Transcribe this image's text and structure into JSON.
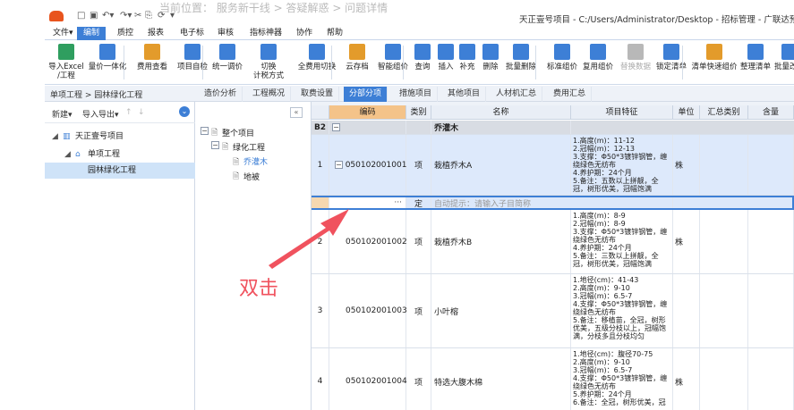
{
  "titlebar": {
    "ghost_text": "当前位置：  服务新干线  >  答疑解惑  >  问题详情",
    "title": "天正壹号项目 - C:/Users/Administrator/Desktop - 招标管理 - 广联达预算计价"
  },
  "menu": [
    "文件▾",
    "编制",
    "质控",
    "报表",
    "电子标",
    "审核",
    "指标神器",
    "协作",
    "帮助"
  ],
  "menu_active": "编制",
  "ribbon": [
    {
      "label": "导入Excel",
      "label2": "/工程",
      "icon": "import-excel-icon",
      "color": "#2f9e5f"
    },
    {
      "label": "量价一体化",
      "label2": "",
      "icon": "quantity-price-icon",
      "color": "#3d7fd6"
    },
    {
      "label": "费用查看",
      "label2": "",
      "icon": "fee-view-icon",
      "color": "#e39b2b"
    },
    {
      "label": "项目自检",
      "label2": "",
      "icon": "self-check-icon",
      "color": "#3d7fd6"
    },
    {
      "label": "统一调价",
      "label2": "",
      "icon": "unify-price-icon",
      "color": "#3d7fd6"
    },
    {
      "label": "切换",
      "label2": "计税方式",
      "icon": "tax-switch-icon",
      "color": "#3d7fd6"
    },
    {
      "label": "全费用切换",
      "label2": "",
      "icon": "full-fee-icon",
      "color": "#3d7fd6"
    },
    {
      "label": "云存档",
      "label2": "",
      "icon": "cloud-save-icon",
      "color": "#e39b2b"
    },
    {
      "label": "智能组价",
      "label2": "",
      "icon": "smart-price-icon",
      "color": "#3d7fd6"
    },
    {
      "label": "查询",
      "label2": "",
      "icon": "query-icon",
      "color": "#3d7fd6"
    },
    {
      "label": "插入",
      "label2": "",
      "icon": "insert-icon",
      "color": "#3d7fd6"
    },
    {
      "label": "补充",
      "label2": "",
      "icon": "supplement-icon",
      "color": "#3d7fd6"
    },
    {
      "label": "删除",
      "label2": "",
      "icon": "delete-icon",
      "color": "#3d7fd6"
    },
    {
      "label": "批量删除",
      "label2": "",
      "icon": "batch-delete-icon",
      "color": "#3d7fd6"
    },
    {
      "label": "标准组价",
      "label2": "",
      "icon": "standard-price-icon",
      "color": "#3d7fd6"
    },
    {
      "label": "复用组价",
      "label2": "",
      "icon": "reuse-price-icon",
      "color": "#3d7fd6"
    },
    {
      "label": "替换数据",
      "label2": "",
      "icon": "replace-data-icon",
      "color": "#b8b8b8"
    },
    {
      "label": "锁定清单",
      "label2": "",
      "icon": "lock-list-icon",
      "color": "#3d7fd6"
    },
    {
      "label": "清单快速组价",
      "label2": "",
      "icon": "quick-price-icon",
      "color": "#e39b2b"
    },
    {
      "label": "整理清单",
      "label2": "",
      "icon": "sort-list-icon",
      "color": "#3d7fd6"
    },
    {
      "label": "批量改主",
      "label2": "",
      "icon": "batch-change-icon",
      "color": "#3d7fd6"
    }
  ],
  "breadcrumb": "单项工程 > 园林绿化工程",
  "tabs": [
    "造价分析",
    "工程概况",
    "取费设置",
    "分部分项",
    "措施项目",
    "其他项目",
    "人材机汇总",
    "费用汇总"
  ],
  "tab_active": "分部分项",
  "left_toolbar": {
    "new": "新建▾",
    "import_export": "导入导出▾",
    "up": "↑",
    "down": "↓"
  },
  "project_tree": [
    {
      "label": "天正壹号项目",
      "level": 0
    },
    {
      "label": "单项工程",
      "level": 1
    },
    {
      "label": "园林绿化工程",
      "level": 2
    }
  ],
  "division_tree": [
    {
      "label": "整个项目",
      "level": 0
    },
    {
      "label": "绿化工程",
      "level": 1
    },
    {
      "label": "乔灌木",
      "level": 2
    },
    {
      "label": "地被",
      "level": 2
    }
  ],
  "grid": {
    "headers": [
      "",
      "编码",
      "类别",
      "名称",
      "项目特征",
      "单位",
      "汇总类别",
      "含量"
    ],
    "group_row": {
      "seq": "B2",
      "name": "乔灌木"
    },
    "rows": [
      {
        "seq": "1",
        "code": "050102001001",
        "type": "项",
        "name": "栽植乔木A",
        "unit": "株",
        "feature": "1.高度(m)：11-12\n2.冠幅(m)：12-13\n3.支撑：Φ50*3镀锌钢管，缠绕绿色无纺布\n4.养护期：24个月\n5.备注：五数以上拼靓，全冠，树形优美，冠幅饱满"
      },
      {
        "seq": "",
        "code": "",
        "type": "定",
        "name": "自动提示：请输入子目简称",
        "unit": "",
        "feature": ""
      },
      {
        "seq": "2",
        "code": "050102001002",
        "type": "项",
        "name": "栽植乔木B",
        "unit": "株",
        "feature": "1.高度(m)：8-9\n2.冠幅(m)：8-9\n3.支撑：Φ50*3镀锌钢管，缠绕绿色无纺布\n4.养护期：24个月\n5.备注：三数以上拼靓，全冠，树形优美，冠幅饱满"
      },
      {
        "seq": "3",
        "code": "050102001003",
        "type": "项",
        "name": "小叶榕",
        "unit": "",
        "feature": "1.地径(cm)：41-43\n2.高度(m)：9-10\n3.冠幅(m)：6.5-7\n4.支撑：Φ50*3镀锌钢管，缠绕绿色无纺布\n5.备注：移植苗，全冠，树形优美，五级分枝以上，冠幅饱满，分枝多且分枝均匀"
      },
      {
        "seq": "4",
        "code": "050102001004",
        "type": "项",
        "name": "特选大腹木棉",
        "unit": "株",
        "feature": "1.地径(cm)：腹径70-75\n2.高度(m)：9-10\n3.冠幅(m)：6.5-7\n4.支撑：Φ50*3镀锌钢管，缠绕绿色无纺布\n5.养护期：24个月\n6.备注：全冠，树形优美，冠"
      }
    ]
  },
  "annotation": "双击",
  "colors": {
    "accent": "#3d7fd6",
    "header_bg": "#e9eef6",
    "row_selected": "#d6e6fb",
    "annotation": "#f0525e"
  }
}
